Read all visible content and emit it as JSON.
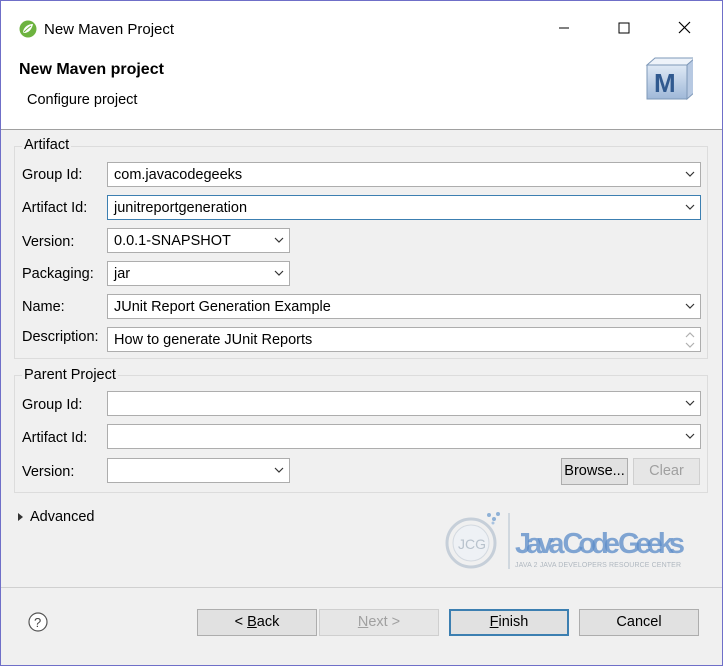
{
  "window": {
    "title": "New Maven Project",
    "controls": {
      "minimize": "—",
      "maximize": "☐",
      "close": "✕"
    }
  },
  "header": {
    "title": "New Maven project",
    "subtitle": "Configure project",
    "logo_letter": "M"
  },
  "artifact": {
    "legend": "Artifact",
    "group_id": {
      "label": "Group Id:",
      "value": "com.javacodegeeks"
    },
    "artifact_id": {
      "label": "Artifact Id:",
      "value": "junitreportgeneration"
    },
    "version": {
      "label": "Version:",
      "value": "0.0.1-SNAPSHOT"
    },
    "packaging": {
      "label": "Packaging:",
      "value": "jar"
    },
    "name": {
      "label": "Name:",
      "value": "JUnit Report Generation Example"
    },
    "description": {
      "label": "Description:",
      "value": "How to generate JUnit Reports"
    }
  },
  "parent": {
    "legend": "Parent Project",
    "group_id": {
      "label": "Group Id:",
      "value": ""
    },
    "artifact_id": {
      "label": "Artifact Id:",
      "value": ""
    },
    "version": {
      "label": "Version:",
      "value": ""
    },
    "browse_label": "Browse...",
    "clear_label": "Clear"
  },
  "advanced": {
    "label": "Advanced"
  },
  "watermark": {
    "brand": "Java Code Geeks",
    "tagline": "JAVA 2 JAVA DEVELOPERS RESOURCE CENTER",
    "badge": "JCG"
  },
  "footer": {
    "help_glyph": "?",
    "back": {
      "prefix": "< ",
      "key": "B",
      "rest": "ack"
    },
    "next": {
      "prefix": "",
      "key": "N",
      "rest": "ext >"
    },
    "finish": {
      "prefix": "",
      "key": "F",
      "rest": "inish"
    },
    "cancel_label": "Cancel"
  },
  "colors": {
    "accent": "#3c7fb1",
    "window_border": "#6f6fc8",
    "watermark_blue": "#4a80c0"
  }
}
